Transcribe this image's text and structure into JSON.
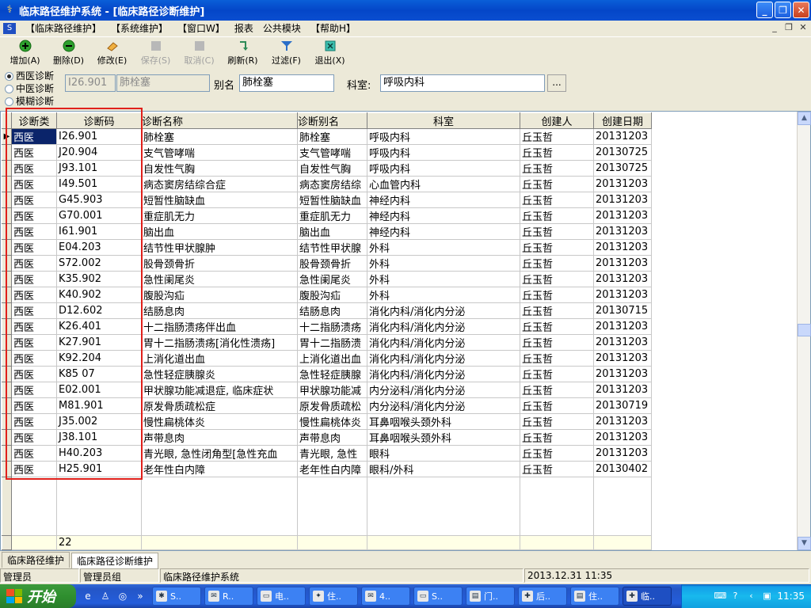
{
  "window": {
    "title": "临床路径维护系统 - [临床路径诊断维护]"
  },
  "menu": {
    "items": [
      "【临床路径维护】",
      "【系统维护】",
      "【窗口W】",
      "报表",
      "公共模块",
      "【帮助H】"
    ]
  },
  "toolbar": {
    "buttons": [
      {
        "label": "增加(A)",
        "icon": "plus-circle-icon",
        "color": "#1F8A1F",
        "enabled": true
      },
      {
        "label": "删除(D)",
        "icon": "minus-circle-icon",
        "color": "#1F8A1F",
        "enabled": true
      },
      {
        "label": "修改(E)",
        "icon": "eraser-icon",
        "color": "#E8A030",
        "enabled": true
      },
      {
        "label": "保存(S)",
        "icon": "save-icon",
        "color": "#A0A0A0",
        "enabled": false
      },
      {
        "label": "取消(C)",
        "icon": "cancel-icon",
        "color": "#A0A0A0",
        "enabled": false
      },
      {
        "label": "刷新(R)",
        "icon": "refresh-icon",
        "color": "#2E8B57",
        "enabled": true
      },
      {
        "label": "过滤(F)",
        "icon": "filter-icon",
        "color": "#2A6EC8",
        "enabled": true
      },
      {
        "label": "退出(X)",
        "icon": "exit-icon",
        "color": "#1E9E8E",
        "enabled": true
      }
    ]
  },
  "filter": {
    "radios": [
      "西医诊断",
      "中医诊断",
      "模糊诊断"
    ],
    "selected_radio": 0,
    "code": "I26.901",
    "name": "肺栓塞",
    "alias_label": "别名",
    "alias": "肺栓塞",
    "dept_label": "科室:",
    "dept": "呼吸内科",
    "browse_label": "..."
  },
  "grid": {
    "columns": [
      "诊断类",
      "诊断码",
      "诊断名称",
      "诊断别名",
      "科室",
      "创建人",
      "创建日期"
    ],
    "rows": [
      [
        "西医",
        "I26.901",
        "肺栓塞",
        "肺栓塞",
        "呼吸内科",
        "丘玉哲",
        "20131203"
      ],
      [
        "西医",
        "J20.904",
        "支气管哮喘",
        "支气管哮喘",
        "呼吸内科",
        "丘玉哲",
        "20130725"
      ],
      [
        "西医",
        "J93.101",
        "自发性气胸",
        "自发性气胸",
        "呼吸内科",
        "丘玉哲",
        "20130725"
      ],
      [
        "西医",
        "I49.501",
        "病态窦房结综合症",
        "病态窦房结综",
        "心血管内科",
        "丘玉哲",
        "20131203"
      ],
      [
        "西医",
        "G45.903",
        "短暂性脑缺血",
        "短暂性脑缺血",
        "神经内科",
        "丘玉哲",
        "20131203"
      ],
      [
        "西医",
        "G70.001",
        "重症肌无力",
        "重症肌无力",
        "神经内科",
        "丘玉哲",
        "20131203"
      ],
      [
        "西医",
        "I61.901",
        "脑出血",
        "脑出血",
        "神经内科",
        "丘玉哲",
        "20131203"
      ],
      [
        "西医",
        "E04.203",
        "结节性甲状腺肿",
        "结节性甲状腺",
        "外科",
        "丘玉哲",
        "20131203"
      ],
      [
        "西医",
        "S72.002",
        "股骨颈骨折",
        "股骨颈骨折",
        "外科",
        "丘玉哲",
        "20131203"
      ],
      [
        "西医",
        "K35.902",
        "急性阑尾炎",
        "急性阑尾炎",
        "外科",
        "丘玉哲",
        "20131203"
      ],
      [
        "西医",
        "K40.902",
        "腹股沟疝",
        "腹股沟疝",
        "外科",
        "丘玉哲",
        "20131203"
      ],
      [
        "西医",
        "D12.602",
        "结肠息肉",
        "结肠息肉",
        "消化内科/消化内分泌",
        "丘玉哲",
        "20130715"
      ],
      [
        "西医",
        "K26.401",
        "十二指肠溃疡伴出血",
        "十二指肠溃疡",
        "消化内科/消化内分泌",
        "丘玉哲",
        "20131203"
      ],
      [
        "西医",
        "K27.901",
        "胃十二指肠溃疡[消化性溃疡]",
        "胃十二指肠溃",
        "消化内科/消化内分泌",
        "丘玉哲",
        "20131203"
      ],
      [
        "西医",
        "K92.204",
        "上消化道出血",
        "上消化道出血",
        "消化内科/消化内分泌",
        "丘玉哲",
        "20131203"
      ],
      [
        "西医",
        "K85 07",
        "急性轻症胰腺炎",
        "急性轻症胰腺",
        "消化内科/消化内分泌",
        "丘玉哲",
        "20131203"
      ],
      [
        "西医",
        "E02.001",
        "甲状腺功能减退症, 临床症状",
        "甲状腺功能减",
        "内分泌科/消化内分泌",
        "丘玉哲",
        "20131203"
      ],
      [
        "西医",
        "M81.901",
        "原发骨质疏松症",
        "原发骨质疏松",
        "内分泌科/消化内分泌",
        "丘玉哲",
        "20130719"
      ],
      [
        "西医",
        "J35.002",
        "慢性扁桃体炎",
        "慢性扁桃体炎",
        "耳鼻咽喉头颈外科",
        "丘玉哲",
        "20131203"
      ],
      [
        "西医",
        "J38.101",
        "声带息肉",
        "声带息肉",
        "耳鼻咽喉头颈外科",
        "丘玉哲",
        "20131203"
      ],
      [
        "西医",
        "H40.203",
        "青光眼, 急性闭角型[急性充血",
        "青光眼, 急性",
        "眼科",
        "丘玉哲",
        "20131203"
      ],
      [
        "西医",
        "H25.901",
        "老年性白内障",
        "老年性白内障",
        "眼科/外科",
        "丘玉哲",
        "20130402"
      ]
    ],
    "count": "22"
  },
  "tabs": [
    "临床路径维护",
    "临床路径诊断维护"
  ],
  "active_tab": 1,
  "status": {
    "user": "管理员",
    "group": "管理员组",
    "system": "临床路径维护系统",
    "datetime": "2013.12.31 11:35"
  },
  "taskbar": {
    "start_label": "开始",
    "tasks": [
      "S..",
      "R..",
      "电..",
      "住..",
      "4..",
      "S..",
      "门..",
      "后..",
      "住..",
      "临.."
    ],
    "clock": "11:35"
  },
  "colors": {
    "selection": "#0A246A",
    "highlight_box": "#E0201B",
    "title_bar": "#0A5FD8"
  }
}
